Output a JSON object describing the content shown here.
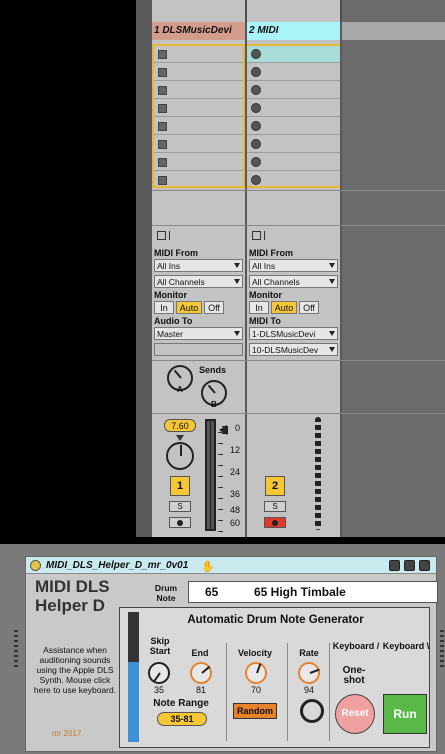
{
  "tracks": [
    {
      "name": "1 DLSMusicDevi"
    },
    {
      "name": "2 MIDI"
    }
  ],
  "io": {
    "midi_from_label": "MIDI From",
    "midi_from_value": "All Ins",
    "channel_value": "All Channels",
    "monitor_label": "Monitor",
    "monitor_in": "In",
    "monitor_auto": "Auto",
    "monitor_off": "Off",
    "audio_to_label": "Audio To",
    "audio_to_value": "Master",
    "midi_to_label": "MIDI To",
    "midi_to_value": "1-DLSMusicDevi",
    "midi_to_sub": "10-DLSMusicDev"
  },
  "sends": {
    "label": "Sends",
    "a": "A",
    "b": "B"
  },
  "mixer": {
    "volume": "7.60",
    "track1_num": "1",
    "track2_num": "2",
    "solo": "S",
    "meter_ticks": [
      "0",
      "12",
      "24",
      "36",
      "48",
      "60"
    ]
  },
  "device": {
    "title": "MIDI_DLS_Helper_D_mr_0v01",
    "name": "MIDI DLS Helper D",
    "drum_note_label": "Drum Note",
    "drum_note_value": "65",
    "drum_note_name": "65 High Timbale",
    "assistance": "Assistance when auditioning sounds using the Apple DLS Synth. Mouse click here to use keyboard.",
    "author": "mr 2017",
    "generator_title": "Automatic Drum Note Generator",
    "skip_start_label": "Skip Start",
    "skip_start_value": "35",
    "end_label": "End",
    "end_value": "81",
    "note_range_label": "Note Range",
    "note_range_value": "35-81",
    "velocity_label": "Velocity",
    "velocity_value": "70",
    "random_label": "Random",
    "rate_label": "Rate",
    "rate_value": "94",
    "keyboard1_label": "Keyboard /",
    "oneshot_label": "One-shot",
    "keyboard2_label": "Keyboard \\",
    "reset_label": "Reset",
    "run_label": "Run"
  },
  "colors": {
    "track1": "#d49c8c",
    "track2": "#a8f4f8",
    "accent_yellow": "#f5c734",
    "run_green": "#58b848",
    "random_orange": "#e5822a",
    "meter_blue": "#3f8fd8"
  }
}
